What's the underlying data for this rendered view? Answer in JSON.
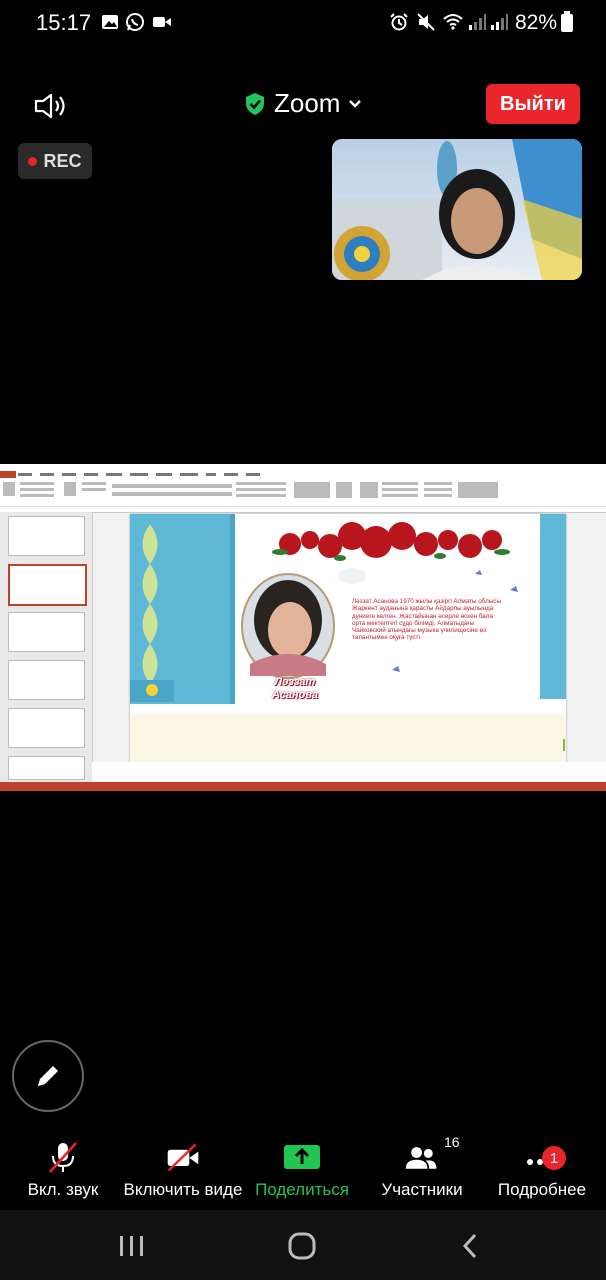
{
  "status_bar": {
    "time": "15:17",
    "battery": "82%"
  },
  "header": {
    "app_title": "Zoom",
    "leave_label": "Выйти"
  },
  "recording": {
    "label": "REC"
  },
  "shared_screen": {
    "slide_text": "Ләззат Асанова 1970 жылы қазіргі Алматы облысы Жаркент ауданына қарасты Айдарлы ауылында дүниеге келген. Жастайынан әсерле өскен бала орта мектептегі сұдо білімді, Алматыдағы Чайковский атындағы музыка училищесіне өз талантымен оқуға түсті.",
    "poet_name_line1": "Ләззат",
    "poet_name_line2": "Асанова"
  },
  "toolbar": {
    "mute_label": "Вкл. звук",
    "video_label": "Включить виде",
    "share_label": "Поделиться",
    "participants_label": "Участники",
    "participants_count": "16",
    "more_label": "Подробнее",
    "more_badge": "1"
  },
  "colors": {
    "accent_green": "#22c55e",
    "leave_red": "#e8262b",
    "share_green": "#23c552"
  }
}
